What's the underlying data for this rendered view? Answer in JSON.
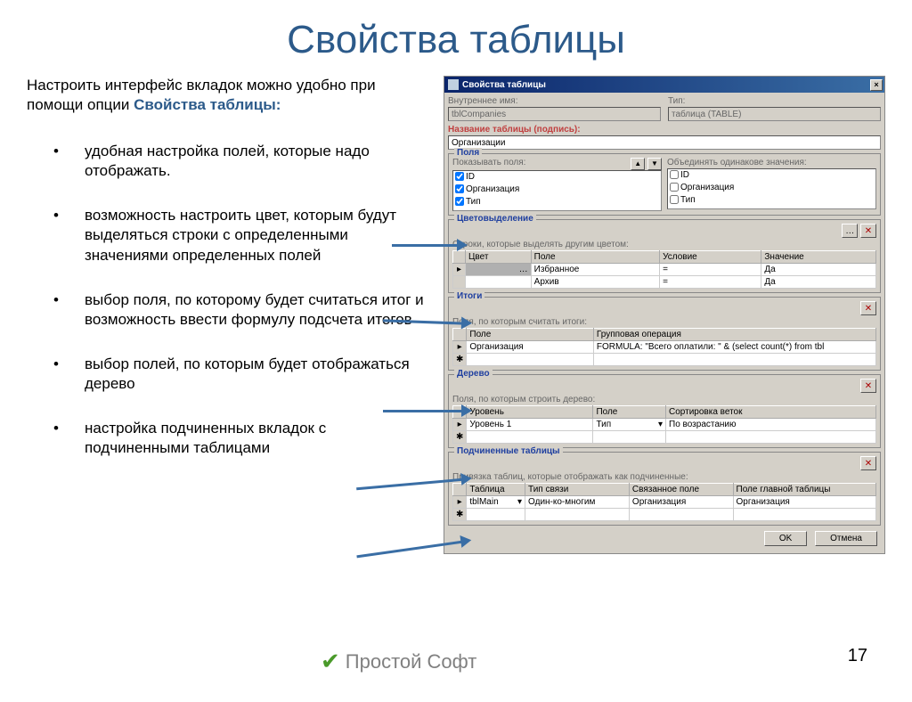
{
  "slide": {
    "title": "Свойства таблицы",
    "intro_a": "Настроить интерфейс вкладок можно удобно при помощи опции ",
    "intro_b": "Свойства таблицы:",
    "bullets": [
      "удобная настройка полей, которые надо отображать.",
      "возможность настроить цвет, которым будут выделяться строки с определенными значениями определенных полей",
      "выбор поля, по которому будет считаться итог и возможность ввести формулу подсчета итогов",
      "выбор полей, по которым будет отображаться дерево",
      "настройка подчиненных вкладок с подчиненными таблицами"
    ],
    "page": "17",
    "footer": "Простой Софт"
  },
  "dialog": {
    "title": "Свойства таблицы",
    "close": "×",
    "lbl_internal": "Внутреннее имя:",
    "val_internal": "tblCompanies",
    "lbl_type": "Тип:",
    "val_type": "таблица (TABLE)",
    "lbl_caption": "Название таблицы (подпись):",
    "val_caption": "Организации",
    "grp_fields": "Поля",
    "lbl_showfields": "Показывать поля:",
    "lbl_merge": "Объединять одинакове значения:",
    "fields_show": [
      "ID",
      "Организация",
      "Тип"
    ],
    "fields_merge": [
      "ID",
      "Организация",
      "Тип"
    ],
    "grp_color": "Цветовыделение",
    "lbl_color_desc": "Строки, которые выделять другим цветом:",
    "color_headers": [
      "Цвет",
      "Поле",
      "Условие",
      "Значение"
    ],
    "color_rows": [
      [
        "",
        "Избранное",
        "=",
        "Да"
      ],
      [
        "",
        "Архив",
        "=",
        "Да"
      ]
    ],
    "grp_totals": "Итоги",
    "lbl_totals_desc": "Поля, по которым считать итоги:",
    "totals_headers": [
      "Поле",
      "Групповая операция"
    ],
    "totals_row": [
      "Организация",
      "FORMULA: \"Всего оплатили: \" & (select count(*) from tbl"
    ],
    "grp_tree": "Дерево",
    "lbl_tree_desc": "Поля, по которым строить дерево:",
    "tree_headers": [
      "Уровень",
      "Поле",
      "Сортировка веток"
    ],
    "tree_row": [
      "Уровень 1",
      "Тип",
      "По возрастанию"
    ],
    "grp_sub": "Подчиненные таблицы",
    "lbl_sub_desc": "Привязка таблиц, которые отображать как подчиненные:",
    "sub_headers": [
      "Таблица",
      "Тип связи",
      "Связанное поле",
      "Поле главной таблицы"
    ],
    "sub_row": [
      "tblMain",
      "Один-ко-многим",
      "Организация",
      "Организация"
    ],
    "btn_ok": "OK",
    "btn_cancel": "Отмена"
  }
}
